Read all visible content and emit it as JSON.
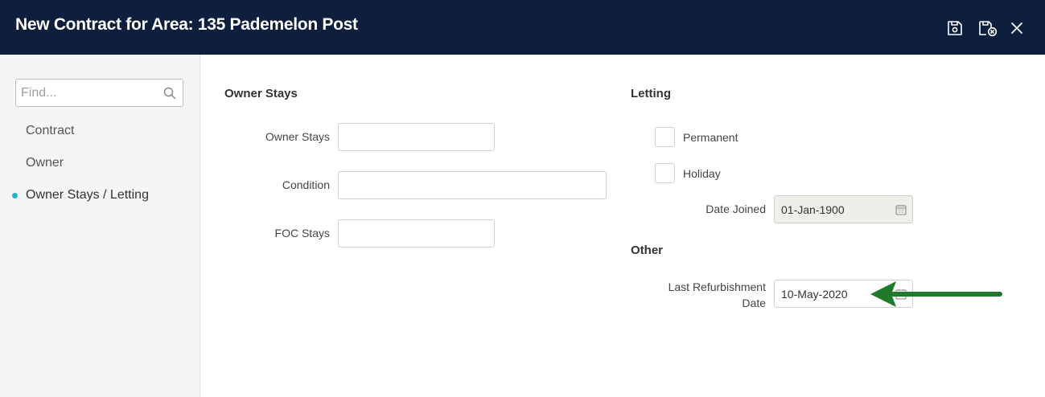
{
  "header": {
    "title": "New Contract for Area: 135 Pademelon Post",
    "icons": [
      "save-icon",
      "save-close-icon",
      "close-icon"
    ]
  },
  "sidebar": {
    "search_placeholder": "Find...",
    "items": [
      {
        "label": "Contract",
        "active": false
      },
      {
        "label": "Owner",
        "active": false
      },
      {
        "label": "Owner Stays / Letting",
        "active": true
      }
    ]
  },
  "owner_stays": {
    "section_title": "Owner Stays",
    "fields": {
      "owner_stays": {
        "label": "Owner Stays",
        "value": ""
      },
      "condition": {
        "label": "Condition",
        "value": ""
      },
      "foc_stays": {
        "label": "FOC Stays",
        "value": ""
      }
    }
  },
  "letting": {
    "section_title": "Letting",
    "permanent": {
      "label": "Permanent",
      "checked": false
    },
    "holiday": {
      "label": "Holiday",
      "checked": false
    },
    "date_joined": {
      "label": "Date Joined",
      "value": "01-Jan-1900",
      "disabled": true
    }
  },
  "other": {
    "section_title": "Other",
    "last_refurbishment_date": {
      "label_line1": "Last Refurbishment",
      "label_line2": "Date",
      "value": "10-May-2020"
    }
  },
  "colors": {
    "header_bg": "#0d1f3c",
    "accent": "#1fb8c9",
    "annotation_arrow": "#1f7a2a"
  }
}
